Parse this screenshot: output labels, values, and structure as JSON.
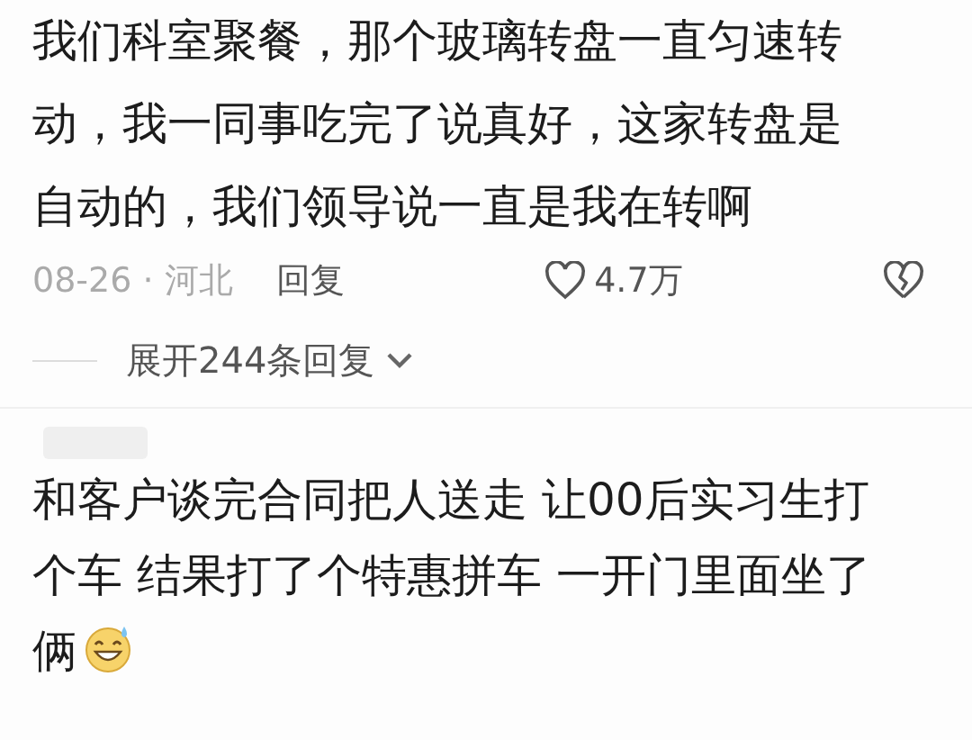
{
  "comments": [
    {
      "lines": [
        "我们科室聚餐，那个玻璃转盘一直匀速转",
        "动，我一同事吃完了说真好，这家转盘是",
        "自动的，我们领导说一直是我在转啊"
      ],
      "date": "08-26",
      "separator": "·",
      "location": "河北",
      "reply_label": "回复",
      "likes": "4.7万",
      "expand_label": "展开244条回复"
    },
    {
      "lines": [
        "和客户谈完合同把人送走 让00后实习生打",
        "个车 结果打了个特惠拼车 一开门里面坐了",
        "俩"
      ],
      "emoji_after": true
    }
  ]
}
